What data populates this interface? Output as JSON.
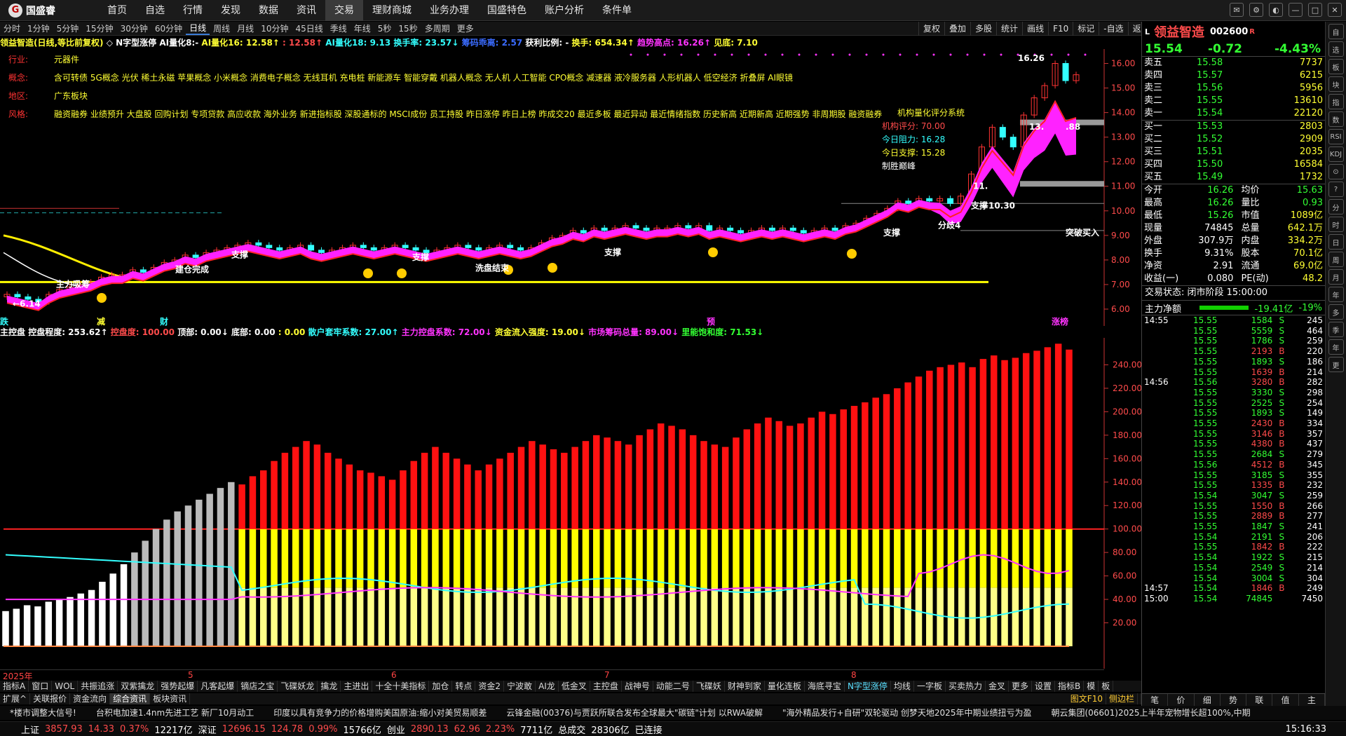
{
  "app": {
    "logo": "国盛睿",
    "menu": [
      "首页",
      "自选",
      "行情",
      "发现",
      "数据",
      "资讯",
      "交易",
      "理财商城",
      "业务办理",
      "国盛特色",
      "账户分析",
      "条件单"
    ],
    "active_menu": "交易"
  },
  "window_controls": [
    "消息",
    "设置",
    "皮肤",
    "最小化",
    "最大化",
    "关闭"
  ],
  "periods": [
    "分时",
    "1分钟",
    "5分钟",
    "15分钟",
    "30分钟",
    "60分钟",
    "日线",
    "周线",
    "月线",
    "10分钟",
    "45日线",
    "季线",
    "年线",
    "5秒",
    "15秒",
    "多周期",
    "更多"
  ],
  "active_period": "日线",
  "chart_tools": [
    "复权",
    "叠加",
    "多股",
    "统计",
    "画线",
    "F10",
    "标记",
    "-自选",
    "返回"
  ],
  "chart_title": [
    {
      "t": "领益智造(日线,等比前复权)",
      "c": "#ffff33"
    },
    {
      "t": " ◇ N字型涨停",
      "c": "#ffffff"
    },
    {
      "t": "  AI量化8:-",
      "c": "#ffffff"
    },
    {
      "t": "  AI量化16: 12.58↑",
      "c": "#ffff33"
    },
    {
      "t": " : 12.58↑",
      "c": "#ff4b4b"
    },
    {
      "t": "  AI量化18: 9.13",
      "c": "#33ffff"
    },
    {
      "t": "  换手率: 23.57↓",
      "c": "#33ffff"
    },
    {
      "t": "  筹码乖离: 2.57",
      "c": "#3a6bff"
    },
    {
      "t": "  获利比例: -",
      "c": "#ffffff"
    },
    {
      "t": "  换手: 654.34↑",
      "c": "#ffff33"
    },
    {
      "t": "  趋势高点: 16.26↑",
      "c": "#ff33ff"
    },
    {
      "t": "  见底: 7.10",
      "c": "#ffff33"
    }
  ],
  "stock_info": [
    {
      "k": "行业:",
      "v": "元器件"
    },
    {
      "k": "概念:",
      "v": "含可转债 5G概念 光伏 稀土永磁 苹果概念 小米概念 消费电子概念 无线耳机 充电桩 新能源车 智能穿戴 机器人概念 无人机 人工智能 CPO概念 减速器 液冷服务器 人形机器人 低空经济 折叠屏 AI眼镜"
    },
    {
      "k": "地区:",
      "v": "广东板块"
    },
    {
      "k": "风格:",
      "v": "融资融券 业绩预升 大盘股 回购计划 专项贷款 高应收款 海外业务 新进指标股 深股通标的 MSCI成份 员工持股 昨日涨停 昨日上榜 昨成交20 最近多板 最近异动 最近情绪指数 历史新高 近期新高 近期强势 非周期股 融资融券"
    }
  ],
  "system_box": {
    "title": "机构量化评分系统",
    "score_label": "机构评分:",
    "score": "70.00",
    "resist_label": "今日阻力:",
    "resist": "16.28",
    "support_label": "今日支撑:",
    "support": "15.28",
    "brand": "制胜巅峰"
  },
  "chart_annotations": {
    "peak": "16.26",
    "low_arrow": "←6.14",
    "low2": "←10.30",
    "breakout": "突破买入",
    "support": "支撑",
    "build": "建仓完成",
    "main_absorb": "主力吸筹",
    "wash_end": "洗盘结束",
    "div4": "分歧4",
    "n11": "11.",
    "n13": "13.",
    "n88": ".88"
  },
  "bottom_bar_labels": {
    "left1": "跌",
    "left2": "减",
    "left3": "财",
    "right1": "预",
    "right2": "涨榜"
  },
  "chart_data": [
    {
      "type": "candlestick",
      "title": "领益智造(日线,等比前复权)",
      "y_ticks": [
        6.0,
        7.0,
        8.0,
        9.0,
        10.0,
        11.0,
        12.0,
        13.0,
        14.0,
        15.0,
        16.0
      ],
      "ylim": [
        5.6,
        16.3
      ],
      "x_labels": [
        "2025年",
        "5",
        "6",
        "7",
        "8"
      ],
      "closes": [
        6.6,
        6.5,
        6.4,
        6.3,
        6.6,
        6.8,
        6.9,
        7.0,
        7.1,
        7.3,
        7.4,
        7.4,
        7.6,
        7.5,
        7.7,
        7.9,
        8.0,
        8.2,
        8.1,
        8.3,
        8.4,
        8.5,
        8.6,
        8.7,
        8.6,
        8.5,
        8.4,
        8.5,
        8.6,
        8.4,
        8.3,
        8.4,
        8.5,
        8.6,
        8.5,
        8.4,
        8.5,
        8.6,
        8.5,
        8.4,
        8.3,
        8.4,
        8.5,
        8.6,
        8.5,
        8.4,
        8.5,
        8.6,
        8.5,
        8.4,
        8.5,
        8.7,
        8.9,
        9.0,
        9.2,
        9.1,
        9.3,
        9.2,
        9.3,
        9.4,
        9.3,
        9.2,
        9.3,
        9.3,
        9.4,
        9.3,
        9.4,
        9.2,
        9.3,
        9.2,
        9.1,
        9.2,
        9.3,
        9.2,
        9.3,
        9.2,
        9.1,
        9.2,
        9.3,
        9.2,
        9.4,
        9.5,
        9.7,
        9.9,
        10.1,
        10.4,
        10.3,
        10.5,
        10.4,
        10.5,
        10.3,
        10.6,
        11.5,
        12.6,
        13.4,
        13.0,
        12.6,
        13.9,
        14.6,
        15.1,
        16.0,
        15.3,
        15.54
      ],
      "ma_yellow_label": "见底",
      "support_line": 7.1
    },
    {
      "type": "bar",
      "title": "主控盘",
      "y_ticks": [
        20,
        40,
        60,
        80,
        100,
        120,
        140,
        160,
        180,
        200,
        220,
        240
      ],
      "ylim": [
        0,
        260
      ],
      "values": [
        30,
        32,
        35,
        34,
        38,
        40,
        42,
        45,
        48,
        55,
        62,
        70,
        80,
        90,
        100,
        108,
        115,
        120,
        125,
        130,
        135,
        140,
        138,
        145,
        150,
        158,
        165,
        170,
        175,
        172,
        165,
        160,
        155,
        150,
        148,
        145,
        142,
        150,
        158,
        165,
        170,
        165,
        160,
        155,
        150,
        155,
        160,
        165,
        170,
        175,
        172,
        168,
        165,
        170,
        175,
        180,
        178,
        175,
        172,
        180,
        185,
        190,
        188,
        185,
        180,
        175,
        172,
        170,
        178,
        185,
        190,
        195,
        192,
        188,
        190,
        195,
        200,
        198,
        202,
        205,
        208,
        212,
        215,
        220,
        225,
        230,
        235,
        238,
        240,
        242,
        238,
        245,
        248,
        244,
        246,
        250,
        252,
        255,
        258,
        253
      ],
      "metrics": [
        {
          "t": "主控盘",
          "c": "#ffffff"
        },
        {
          "t": " 控盘程度: 253.62↑",
          "c": "#ffffff"
        },
        {
          "t": "  控盘度: 100.00",
          "c": "#ff4b4b"
        },
        {
          "t": "  顶部: 0.00↓",
          "c": "#ffffff"
        },
        {
          "t": "  底部: 0.00",
          "c": "#ffffff"
        },
        {
          "t": " : 0.00",
          "c": "#ffff33"
        },
        {
          "t": "  散户套牢系数: 27.00↑",
          "c": "#33ffff"
        },
        {
          "t": "  主力控盘系数: 72.00↓",
          "c": "#ff33ff"
        },
        {
          "t": "  资金流入强度: 19.00↓",
          "c": "#ffff33"
        },
        {
          "t": "  市场筹码总量: 89.00↓",
          "c": "#ff33ff"
        },
        {
          "t": "  里能饱和度: 71.53↓",
          "c": "#33ff33"
        }
      ]
    }
  ],
  "bottom_tabs1": [
    "指标A",
    "窗口",
    "WOL",
    "共振追涨",
    "双紫擒龙",
    "强势起爆",
    "凡客起爆",
    "镝店之宝",
    "飞碟妖龙",
    "擒龙",
    "主进出",
    "十全十美指标",
    "加仓",
    "转点",
    "资金2",
    "宁波敢",
    "AI龙",
    "低金叉",
    "主控盘",
    "战神号",
    "动能二号",
    "飞碟妖",
    "财神到家",
    "量化连板",
    "海底寻宝",
    "N字型涨停",
    "均线",
    "一字板",
    "买卖热力",
    "金叉",
    "更多",
    "设置",
    "指标B",
    "模",
    "板"
  ],
  "bottom_tabs2": [
    "扩展^",
    "关联报价",
    "资金流向",
    "综合资讯",
    "板块资讯"
  ],
  "bottom_right_tabs": [
    "图文F10",
    "侧边栏"
  ],
  "news": [
    "*楼市调整大信号!",
    "台积电加速1.4nm先进工艺 新厂10月动工",
    "印度以具有竞争力的价格增购美国原油:缩小对美贸易顺差",
    "云锋金融(00376)与贾跃所联合发布全球最大\"碳链\"计划 以RWA破解",
    "\"海外精品发行+自研\"双轮驱动 创梦天地2025年中期业绩扭亏为盈",
    "朝云集团(06601)2025上半年宠物增长超100%,中期"
  ],
  "status_bar": {
    "sh_label": "上证",
    "sh": "3857.93",
    "sh_chg": "14.33",
    "sh_pct": "0.37%",
    "sh_amt": "12217亿",
    "sz_label": "深证",
    "sz": "12696.15",
    "sz_chg": "124.78",
    "sz_pct": "0.99%",
    "sz_amt": "15766亿",
    "cy_label": "创业",
    "cy": "2890.13",
    "cy_chg": "62.96",
    "cy_pct": "2.23%",
    "cy_amt": "7711亿",
    "total_label": "总成交",
    "total": "28306亿",
    "conn": "已连接",
    "time": "15:16:33"
  },
  "quote": {
    "name": "领益智造",
    "code": "002600",
    "flag": "R",
    "price": "15.54",
    "change": "-0.72",
    "pct": "-4.43%",
    "asks": [
      [
        "卖五",
        "15.58",
        "7737"
      ],
      [
        "卖四",
        "15.57",
        "6215"
      ],
      [
        "卖三",
        "15.56",
        "5956"
      ],
      [
        "卖二",
        "15.55",
        "13610"
      ],
      [
        "卖一",
        "15.54",
        "22120"
      ]
    ],
    "bids": [
      [
        "买一",
        "15.53",
        "2803"
      ],
      [
        "买二",
        "15.52",
        "2909"
      ],
      [
        "买三",
        "15.51",
        "2035"
      ],
      [
        "买四",
        "15.50",
        "16584"
      ],
      [
        "买五",
        "15.49",
        "1732"
      ]
    ],
    "stats": [
      [
        "今开",
        "16.26",
        "均价",
        "15.63"
      ],
      [
        "最高",
        "16.26",
        "量比",
        "0.93"
      ],
      [
        "最低",
        "15.26",
        "市值",
        "1089亿"
      ],
      [
        "现量",
        "74845",
        "总量",
        "642.1万"
      ],
      [
        "外盘",
        "307.9万",
        "内盘",
        "334.2万"
      ],
      [
        "换手",
        "9.31%",
        "股本",
        "70.1亿"
      ],
      [
        "净资",
        "2.91",
        "流通",
        "69.0亿"
      ],
      [
        "收益(一)",
        "0.080",
        "PE(动)",
        "48.2"
      ]
    ],
    "trade_state": "交易状态: 闭市阶段 15:00:00",
    "netflow_label": "主力净额",
    "netflow": "-19.41亿",
    "netflow_pct": "-19%",
    "ticks": [
      [
        "14:55",
        "15.55",
        "1584",
        "S",
        "245"
      ],
      [
        "",
        "15.55",
        "5559",
        "S",
        "464"
      ],
      [
        "",
        "15.55",
        "1786",
        "S",
        "259"
      ],
      [
        "",
        "15.55",
        "2193",
        "B",
        "220"
      ],
      [
        "",
        "15.55",
        "1893",
        "S",
        "186"
      ],
      [
        "",
        "15.55",
        "1639",
        "B",
        "214"
      ],
      [
        "14:56",
        "15.56",
        "3280",
        "B",
        "282"
      ],
      [
        "",
        "15.55",
        "3330",
        "S",
        "298"
      ],
      [
        "",
        "15.55",
        "2525",
        "S",
        "254"
      ],
      [
        "",
        "15.55",
        "1893",
        "S",
        "149"
      ],
      [
        "",
        "15.55",
        "2430",
        "B",
        "334"
      ],
      [
        "",
        "15.55",
        "3146",
        "B",
        "357"
      ],
      [
        "",
        "15.55",
        "4380",
        "B",
        "437"
      ],
      [
        "",
        "15.55",
        "2684",
        "S",
        "279"
      ],
      [
        "",
        "15.56",
        "4512",
        "B",
        "345"
      ],
      [
        "",
        "15.55",
        "3185",
        "S",
        "355"
      ],
      [
        "",
        "15.55",
        "1335",
        "B",
        "232"
      ],
      [
        "",
        "15.54",
        "3047",
        "S",
        "259"
      ],
      [
        "",
        "15.55",
        "1550",
        "B",
        "266"
      ],
      [
        "",
        "15.55",
        "2889",
        "B",
        "277"
      ],
      [
        "",
        "15.55",
        "1847",
        "S",
        "241"
      ],
      [
        "",
        "15.54",
        "2191",
        "S",
        "206"
      ],
      [
        "",
        "15.55",
        "1842",
        "B",
        "222"
      ],
      [
        "",
        "15.54",
        "1922",
        "S",
        "215"
      ],
      [
        "",
        "15.54",
        "2549",
        "S",
        "214"
      ],
      [
        "",
        "15.54",
        "3004",
        "S",
        "304"
      ],
      [
        "14:57",
        "15.54",
        "1846",
        "B",
        "249"
      ],
      [
        "15:00",
        "15.54",
        "74845",
        "",
        "7450"
      ]
    ],
    "tabs": [
      "笔",
      "价",
      "细",
      "势",
      "联",
      "值",
      "主"
    ]
  },
  "right_toolbar": [
    "自",
    "选",
    "板",
    "块",
    "指",
    "数",
    "RSI",
    "KDJ",
    "⊙",
    "?",
    "分",
    "时",
    "日",
    "周",
    "月",
    "年",
    "多",
    "季",
    "年",
    "更"
  ]
}
